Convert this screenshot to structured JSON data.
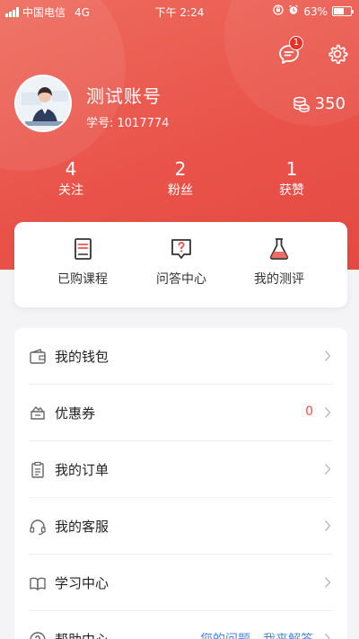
{
  "status_bar": {
    "carrier": "中国电信",
    "network": "4G",
    "time": "下午 2:24",
    "battery": "63%"
  },
  "header": {
    "message_badge": "1"
  },
  "profile": {
    "username": "测试账号",
    "student_id": "学号: 1017774",
    "coins": "350"
  },
  "stats": [
    {
      "value": "4",
      "label": "关注"
    },
    {
      "value": "2",
      "label": "粉丝"
    },
    {
      "value": "1",
      "label": "获赞"
    }
  ],
  "quick_actions": [
    {
      "label": "已购课程",
      "icon": "book-icon"
    },
    {
      "label": "问答中心",
      "icon": "question-chat-icon"
    },
    {
      "label": "我的测评",
      "icon": "flask-icon"
    }
  ],
  "menu": {
    "wallet": {
      "label": "我的钱包",
      "icon": "wallet-icon"
    },
    "coupons": {
      "label": "优惠券",
      "count": "0",
      "icon": "coupon-icon"
    },
    "orders": {
      "label": "我的订单",
      "icon": "clipboard-icon"
    },
    "service": {
      "label": "我的客服",
      "icon": "headset-icon"
    },
    "study": {
      "label": "学习中心",
      "icon": "open-book-icon"
    },
    "help": {
      "label": "帮助中心",
      "link1": "您的问题",
      "link2": "我来解答",
      "icon": "help-icon"
    }
  },
  "colors": {
    "primary": "#e9534a",
    "link": "#4a86e8"
  }
}
